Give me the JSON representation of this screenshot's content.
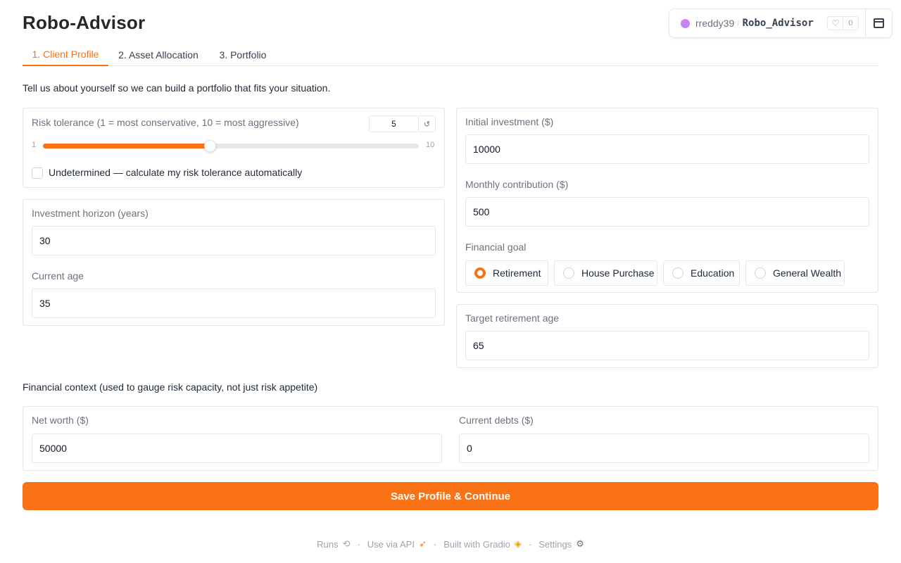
{
  "app": {
    "title": "Robo-Advisor"
  },
  "space": {
    "owner": "rreddy39",
    "separator": "/",
    "repo": "Robo_Advisor",
    "likes": "0"
  },
  "tabs": [
    {
      "label": "1. Client Profile",
      "active": true
    },
    {
      "label": "2. Asset Allocation",
      "active": false
    },
    {
      "label": "3. Portfolio",
      "active": false
    }
  ],
  "intro": "Tell us about yourself so we can build a portfolio that fits your situation.",
  "risk": {
    "label": "Risk tolerance (1 = most conservative, 10 = most aggressive)",
    "value": "5",
    "min": "1",
    "max": "10",
    "fill_fraction": 0.4444,
    "reset_icon": "reset-icon",
    "checkbox_label": "Undetermined — calculate my risk tolerance automatically",
    "checkbox_checked": false
  },
  "horizon": {
    "label": "Investment horizon (years)",
    "value": "30"
  },
  "age": {
    "label": "Current age",
    "value": "35"
  },
  "initial": {
    "label": "Initial investment ($)",
    "value": "10000"
  },
  "monthly": {
    "label": "Monthly contribution ($)",
    "value": "500"
  },
  "goal": {
    "label": "Financial goal",
    "options": [
      "Retirement",
      "House Purchase",
      "Education",
      "General Wealth"
    ],
    "selected": "Retirement"
  },
  "retirement_age": {
    "label": "Target retirement age",
    "value": "65"
  },
  "context_label": "Financial context (used to gauge risk capacity, not just risk appetite)",
  "net_worth": {
    "label": "Net worth ($)",
    "value": "50000"
  },
  "debts": {
    "label": "Current debts ($)",
    "value": "0"
  },
  "submit_label": "Save Profile & Continue",
  "footer": {
    "runs": "Runs",
    "api": "Use via API",
    "built": "Built with Gradio",
    "settings": "Settings",
    "separator": "·"
  },
  "colors": {
    "accent": "#f97316",
    "border": "#e5e7eb",
    "muted": "#6b7280"
  }
}
